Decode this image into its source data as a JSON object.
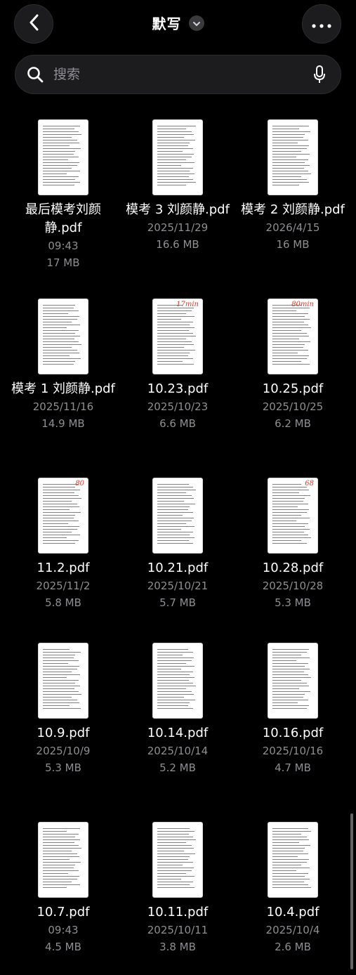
{
  "header": {
    "title": "默写",
    "back_icon": "chevron-left-icon",
    "title_dropdown_icon": "chevron-down-icon",
    "more_icon": "ellipsis-icon"
  },
  "search": {
    "placeholder": "搜索",
    "value": "",
    "mic_icon": "microphone-icon"
  },
  "files": [
    {
      "name": "最后模考刘颜静.pdf",
      "date": "09:43",
      "size": "17 MB",
      "mark": ""
    },
    {
      "name": "模考 3 刘颜静.pdf",
      "date": "2025/11/29",
      "size": "16.6 MB",
      "mark": ""
    },
    {
      "name": "模考 2 刘颜静.pdf",
      "date": "2026/4/15",
      "size": "16 MB",
      "mark": ""
    },
    {
      "name": "模考 1 刘颜静.pdf",
      "date": "2025/11/16",
      "size": "14.9 MB",
      "mark": ""
    },
    {
      "name": "10.23.pdf",
      "date": "2025/10/23",
      "size": "6.6 MB",
      "mark": "17min"
    },
    {
      "name": "10.25.pdf",
      "date": "2025/10/25",
      "size": "6.2 MB",
      "mark": "80min"
    },
    {
      "name": "11.2.pdf",
      "date": "2025/11/2",
      "size": "5.8 MB",
      "mark": "80"
    },
    {
      "name": "10.21.pdf",
      "date": "2025/10/21",
      "size": "5.7 MB",
      "mark": ""
    },
    {
      "name": "10.28.pdf",
      "date": "2025/10/28",
      "size": "5.3 MB",
      "mark": "68"
    },
    {
      "name": "10.9.pdf",
      "date": "2025/10/9",
      "size": "5.3 MB",
      "mark": ""
    },
    {
      "name": "10.14.pdf",
      "date": "2025/10/14",
      "size": "5.2 MB",
      "mark": ""
    },
    {
      "name": "10.16.pdf",
      "date": "2025/10/16",
      "size": "4.7 MB",
      "mark": ""
    },
    {
      "name": "10.7.pdf",
      "date": "09:43",
      "size": "4.5 MB",
      "mark": ""
    },
    {
      "name": "10.11.pdf",
      "date": "2025/10/11",
      "size": "3.8 MB",
      "mark": ""
    },
    {
      "name": "10.4.pdf",
      "date": "2025/10/4",
      "size": "2.6 MB",
      "mark": ""
    }
  ]
}
